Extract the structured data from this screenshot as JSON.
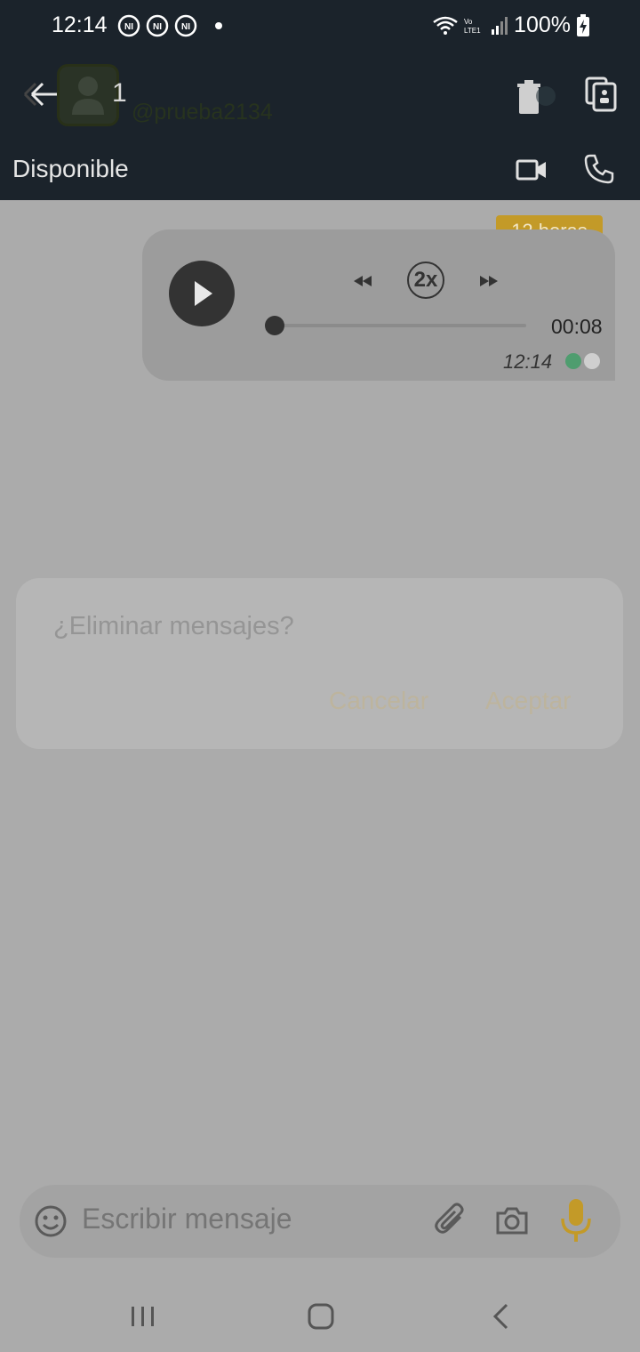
{
  "status_bar": {
    "time": "12:14",
    "battery": "100%",
    "network": "LTE1",
    "notification_icons": [
      "ni-icon",
      "ni-icon",
      "ni-icon"
    ]
  },
  "header": {
    "contact_name": "1",
    "contact_handle": "@prueba2134",
    "presence": "Disponible"
  },
  "message": {
    "expiry_badge": "12 horas",
    "playback_speed": "2x",
    "duration": "00:08",
    "time": "12:14",
    "progress": 0
  },
  "dialog": {
    "title": "¿Eliminar mensajes?",
    "cancel_label": "Cancelar",
    "accept_label": "Aceptar"
  },
  "composer": {
    "placeholder": "Escribir mensaje"
  },
  "colors": {
    "header_bg": "#1b232b",
    "accent": "#c39a28",
    "overlay_bg": "#ababab",
    "read_dot": "#4f9d6f"
  }
}
